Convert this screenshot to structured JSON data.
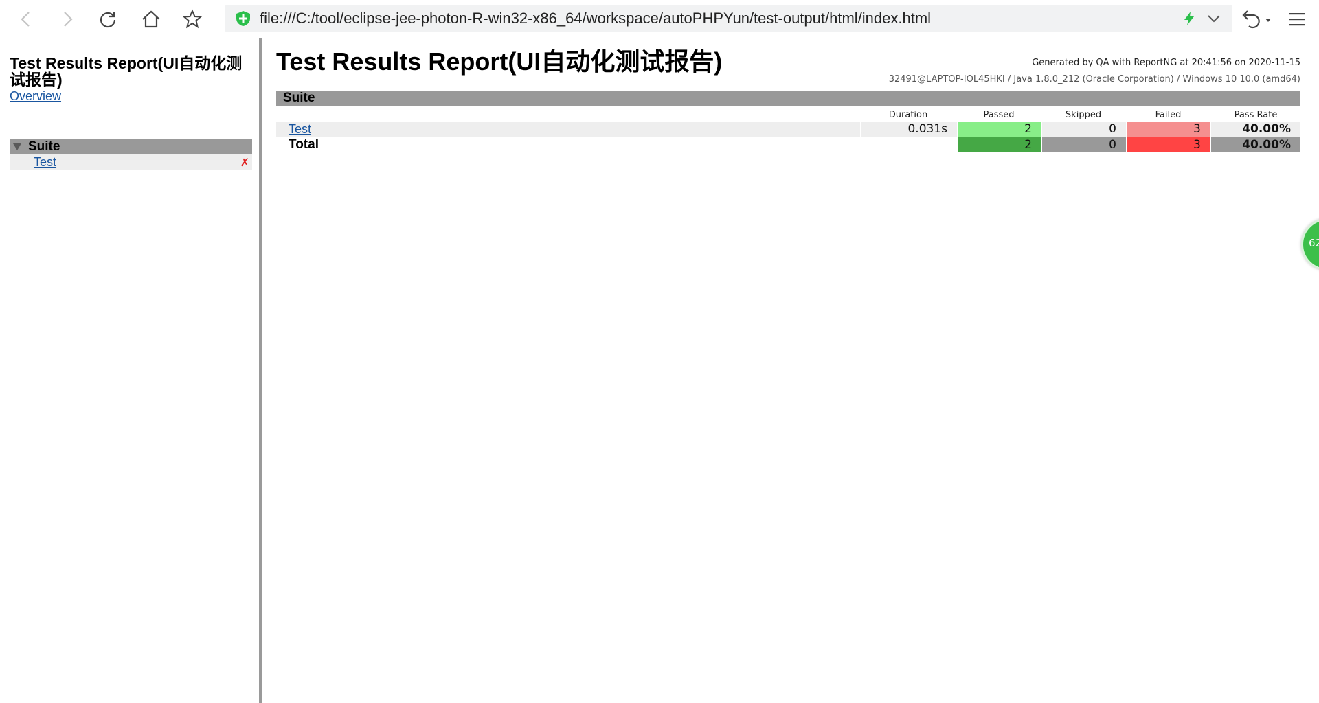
{
  "browser": {
    "url": "file:///C:/tool/eclipse-jee-photon-R-win32-x86_64/workspace/autoPHPYun/test-output/html/index.html"
  },
  "left": {
    "title": "Test Results Report(UI自动化测试报告)",
    "overview_link": "Overview",
    "suite_label": "Suite",
    "suite_items": [
      {
        "label": "Test",
        "status_mark": "✗"
      }
    ]
  },
  "main": {
    "title": "Test Results Report(UI自动化测试报告)",
    "generated_line": "Generated by QA with ReportNG at 20:41:56 on 2020-11-15",
    "system_line": "32491@LAPTOP-IOL45HKI / Java 1.8.0_212 (Oracle Corporation) / Windows 10 10.0 (amd64)",
    "suite_label": "Suite",
    "columns": {
      "duration": "Duration",
      "passed": "Passed",
      "skipped": "Skipped",
      "failed": "Failed",
      "pass_rate": "Pass Rate"
    },
    "rows": [
      {
        "name": "Test",
        "duration": "0.031s",
        "passed": "2",
        "skipped": "0",
        "failed": "3",
        "pass_rate": "40.00%"
      }
    ],
    "total": {
      "label": "Total",
      "passed": "2",
      "skipped": "0",
      "failed": "3",
      "pass_rate": "40.00%"
    }
  },
  "side_badge": {
    "text": "62"
  },
  "colors": {
    "passed_light": "#88ee88",
    "failed_light": "#f58f8f",
    "passed_total": "#45a845",
    "failed_total": "#ff4444",
    "neutral_cell": "#eeeeee",
    "neutral_total": "#999999",
    "link": "#1a56a0"
  }
}
